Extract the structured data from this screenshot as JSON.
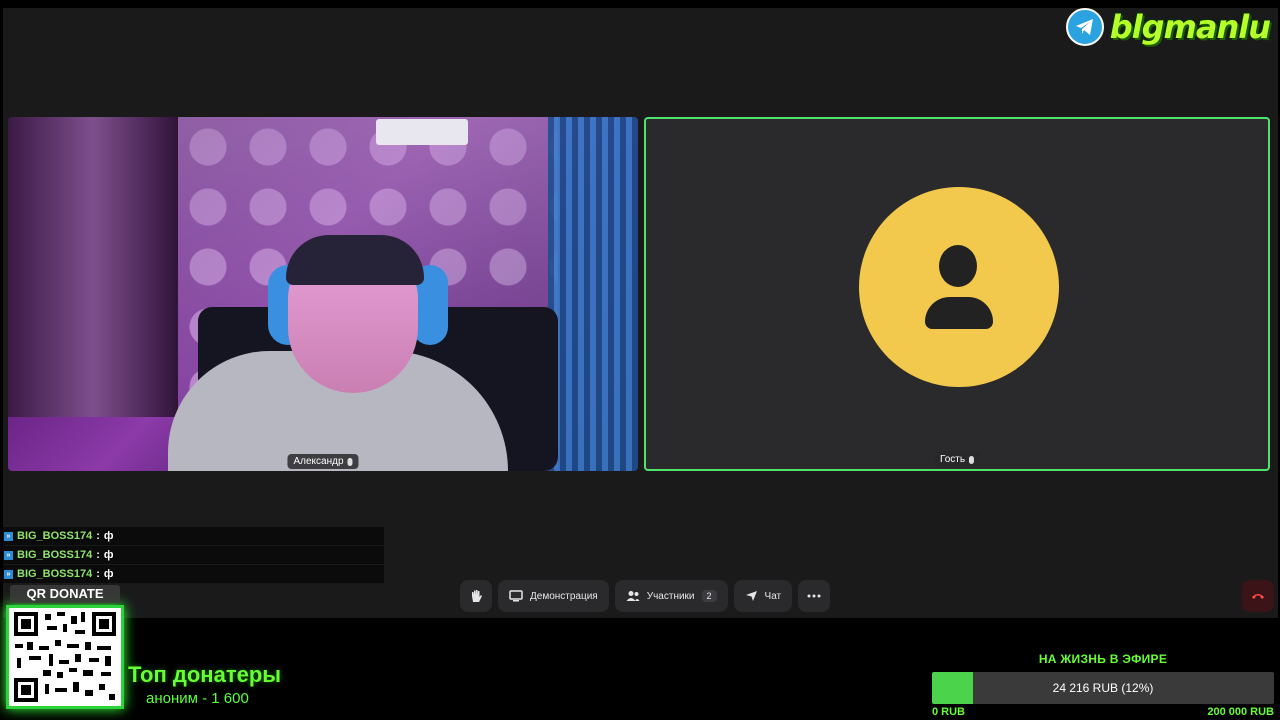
{
  "brand": {
    "name": "blgmanlu",
    "icon": "telegram-icon"
  },
  "participants": [
    {
      "name": "Александр",
      "mic": "mic-icon"
    },
    {
      "name": "Гость",
      "mic": "mic-icon"
    }
  ],
  "chat": {
    "messages": [
      {
        "user": "BIG_BOSS174",
        "sep": ":",
        "text": "ф"
      },
      {
        "user": "BIG_BOSS174",
        "sep": ":",
        "text": "ф"
      },
      {
        "user": "BIG_BOSS174",
        "sep": ":",
        "text": "ф"
      }
    ]
  },
  "controls": {
    "raise_hand_icon": "hand-icon",
    "screenshare_label": "Демонстрация",
    "participants_label": "Участники",
    "participants_count": "2",
    "chat_label": "Чат",
    "more_icon": "more-icon",
    "hangup_icon": "phone-hangup-icon"
  },
  "donate": {
    "qr_label": "QR DONATE"
  },
  "top_donors": {
    "title": "Топ донатеры",
    "entries": [
      "аноним - 1 600"
    ]
  },
  "goal": {
    "title": "НА ЖИЗНЬ В ЭФИРЕ",
    "progress_text": "24 216 RUB (12%)",
    "progress_fraction": 0.12,
    "min_label": "0 RUB",
    "max_label": "200 000 RUB"
  },
  "colors": {
    "speaking_border": "#4ee36a",
    "accent_green": "#66ff33",
    "avatar_bg": "#f2c94c"
  }
}
